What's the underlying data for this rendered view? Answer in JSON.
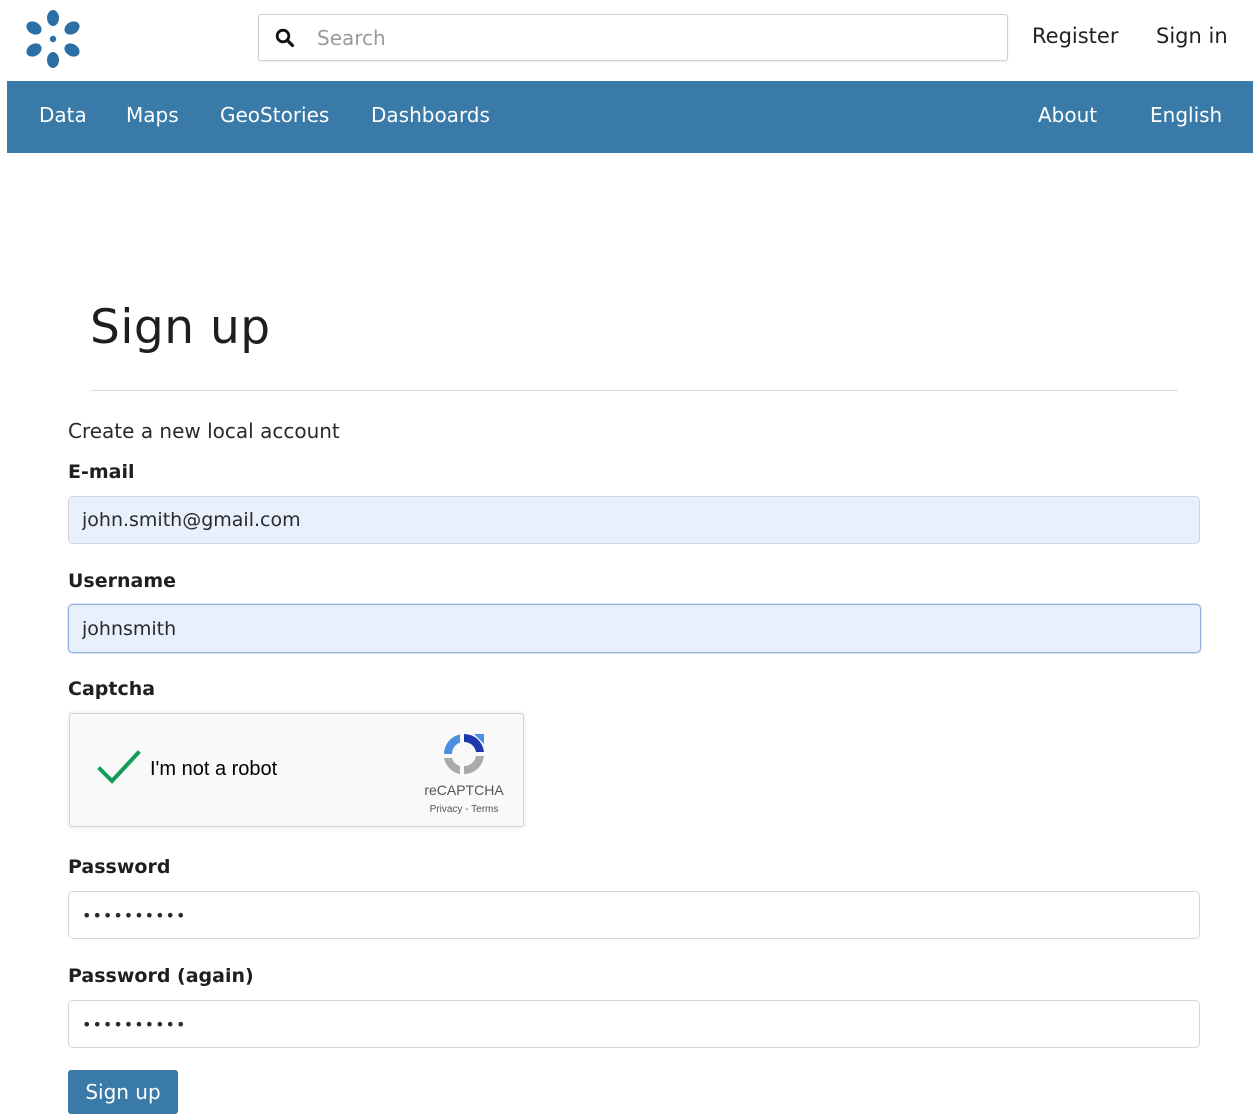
{
  "header": {
    "logo": "geonode-logo-icon",
    "search": {
      "placeholder": "Search",
      "value": ""
    },
    "register_label": "Register",
    "signin_label": "Sign in"
  },
  "nav": {
    "left": [
      "Data",
      "Maps",
      "GeoStories",
      "Dashboards"
    ],
    "right": [
      "About",
      "English"
    ]
  },
  "page": {
    "title": "Sign up",
    "intro": "Create a new local account"
  },
  "form": {
    "email": {
      "label": "E-mail",
      "value": "john.smith@gmail.com"
    },
    "username": {
      "label": "Username",
      "value": "johnsmith"
    },
    "captcha": {
      "label": "Captcha",
      "checkbox_text": "I'm not a robot",
      "checked": true,
      "brand": "reCAPTCHA",
      "links": "Privacy - Terms"
    },
    "password": {
      "label": "Password",
      "value": "••••••••••"
    },
    "password_again": {
      "label": "Password (again)",
      "value": "••••••••••"
    },
    "submit_label": "Sign up"
  },
  "colors": {
    "navbar": "#3a7aa8",
    "button": "#3a7aa8",
    "autofill": "#e8f0fe",
    "check": "#0f9d58"
  }
}
